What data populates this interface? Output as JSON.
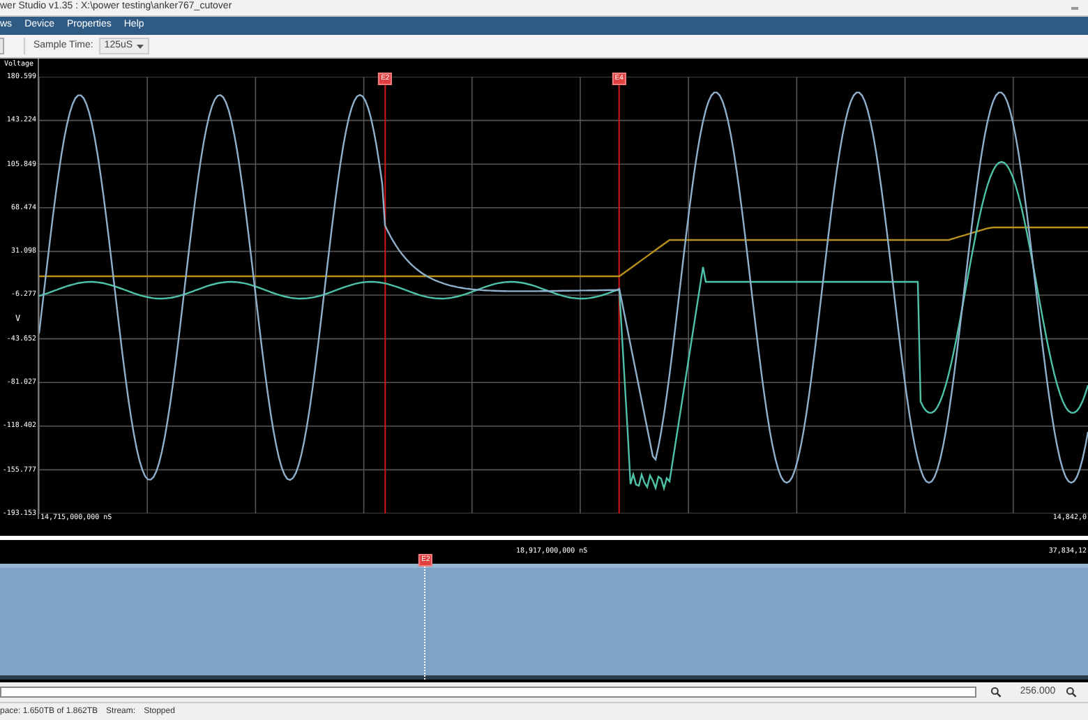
{
  "window": {
    "title": "wer Studio v1.35 : X:\\power testing\\anker767_cutover"
  },
  "menu": [
    {
      "label": "ws"
    },
    {
      "label": "Device"
    },
    {
      "label": "Properties"
    },
    {
      "label": "Help"
    }
  ],
  "toolbar": {
    "sample_time_label": "Sample Time:",
    "sample_time_value": "125uS"
  },
  "chart": {
    "y_title": "Voltage",
    "y_unit": "V",
    "y_ticks": [
      "180.599",
      "143.224",
      "105.849",
      "68.474",
      "31.098",
      "-6.277",
      "-43.652",
      "-81.027",
      "-118.402",
      "-155.777",
      "-193.153"
    ],
    "x_start": "14,715,000,000 nS",
    "x_end": "14,842,0",
    "markers": [
      {
        "label": "E2"
      },
      {
        "label": "E4"
      }
    ]
  },
  "overview": {
    "marker": {
      "label": "E2"
    },
    "center_label": "18,917,000,000 nS",
    "end_label": "37,834,12"
  },
  "zoom": {
    "value": "256.000"
  },
  "status": {
    "space": "pace: 1.650TB of 1.862TB",
    "stream_label": "Stream:",
    "stream_value": "Stopped"
  }
}
